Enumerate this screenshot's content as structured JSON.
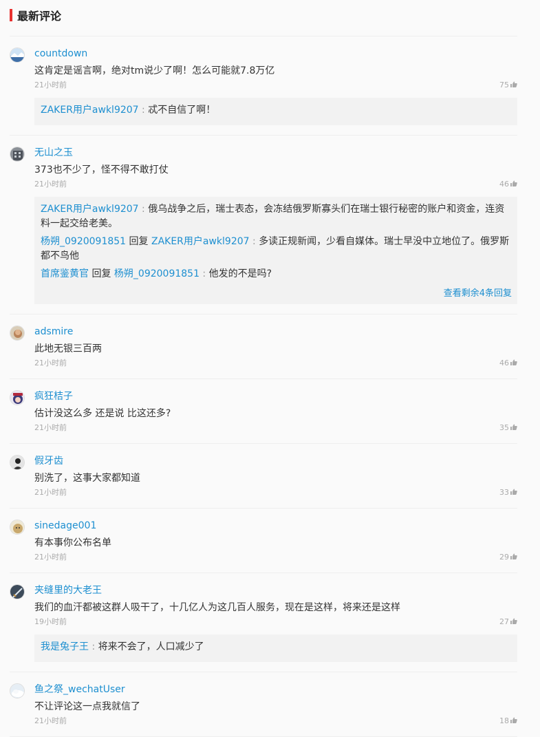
{
  "header": {
    "title": "最新评论"
  },
  "labels": {
    "reply_word": "回复"
  },
  "comments": [
    {
      "author": "countdown",
      "text": "这肯定是谣言啊，绝对tm说少了啊！怎么可能就7.8万亿",
      "time": "21小时前",
      "likes": "75",
      "avatar_icon": "avatar-landscape-icon",
      "replies": [
        {
          "from": "ZAKER用户awkl9207",
          "to": "",
          "text": "忒不自信了啊！"
        }
      ]
    },
    {
      "author": "无山之玉",
      "text": "373也不少了，怪不得不敢打仗",
      "time": "21小时前",
      "likes": "46",
      "avatar_icon": "avatar-building-icon",
      "replies": [
        {
          "from": "ZAKER用户awkl9207",
          "to": "",
          "text": "俄乌战争之后，瑞士表态，会冻结俄罗斯寡头们在瑞士银行秘密的账户和资金，连资料一起交给老美。"
        },
        {
          "from": "杨朔_0920091851",
          "to": "ZAKER用户awkl9207",
          "text": "多读正规新闻，少看自媒体。瑞士早没中立地位了。俄罗斯都不鸟他"
        },
        {
          "from": "首席鉴黄官",
          "to": "杨朔_0920091851",
          "text": "他发的不是吗?"
        }
      ],
      "more_text": "查看剩余4条回复"
    },
    {
      "author": "adsmire",
      "text": "此地无银三百两",
      "time": "21小时前",
      "likes": "46",
      "avatar_icon": "avatar-face-icon",
      "replies": []
    },
    {
      "author": "疯狂桔子",
      "text": "估计没这么多 还是说 比这还多?",
      "time": "21小时前",
      "likes": "35",
      "avatar_icon": "avatar-anime-icon",
      "replies": []
    },
    {
      "author": "假牙齿",
      "text": "别洗了，这事大家都知道",
      "time": "21小时前",
      "likes": "33",
      "avatar_icon": "avatar-dark-figure-icon",
      "replies": []
    },
    {
      "author": "sinedage001",
      "text": "有本事你公布名单",
      "time": "21小时前",
      "likes": "29",
      "avatar_icon": "avatar-dog-icon",
      "replies": []
    },
    {
      "author": "夹缝里的大老王",
      "text": "我们的血汗都被这群人吸干了，十几亿人为这几百人服务，现在是这样，将来还是这样",
      "time": "19小时前",
      "likes": "27",
      "avatar_icon": "avatar-sword-icon",
      "replies": [
        {
          "from": "我是兔子王",
          "to": "",
          "text": "将来不会了，人口减少了"
        }
      ]
    },
    {
      "author": "鱼之祭_wechatUser",
      "text": "不让评论这一点我就信了",
      "time": "21小时前",
      "likes": "18",
      "avatar_icon": "avatar-default-icon",
      "replies": []
    }
  ]
}
